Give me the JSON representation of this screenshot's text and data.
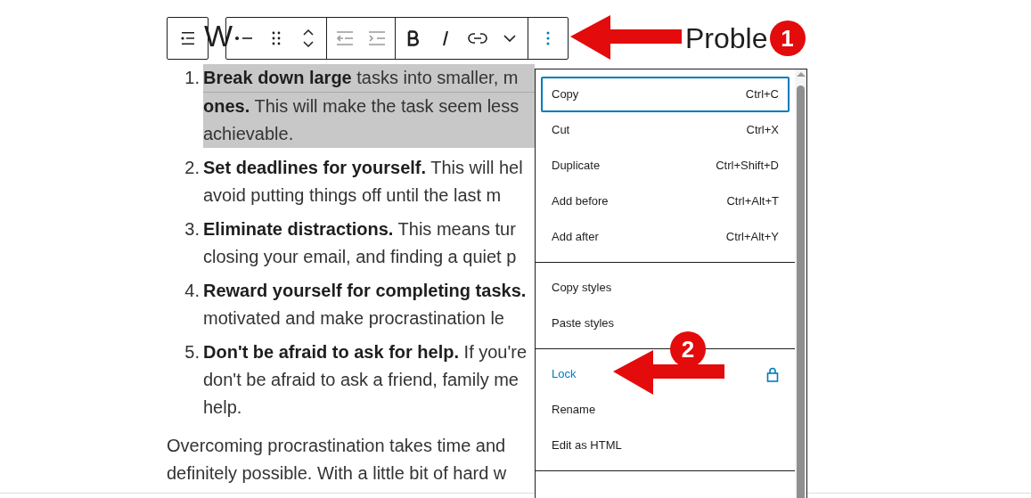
{
  "heading_fragments": [
    "W",
    "Proble"
  ],
  "list": [
    {
      "number": "1.",
      "selected": true,
      "lines": [
        "**Break down large** tasks into smaller, m",
        "**ones.** This will make the task seem less",
        "achievable."
      ]
    },
    {
      "number": "2.",
      "selected": false,
      "lines": [
        "**Set deadlines for yourself.** This will hel",
        "avoid putting things off until the last m"
      ]
    },
    {
      "number": "3.",
      "selected": false,
      "lines": [
        "**Eliminate distractions.** This means tur",
        "closing your email, and finding a quiet p"
      ]
    },
    {
      "number": "4.",
      "selected": false,
      "lines": [
        "**Reward yourself for completing tasks.**",
        "motivated and make procrastination le"
      ]
    },
    {
      "number": "5.",
      "selected": false,
      "lines": [
        "**Don't be afraid to ask for help.** If you're",
        "don't be afraid to ask a friend, family me",
        "help."
      ]
    }
  ],
  "paragraph_lines": [
    "Overcoming procrastination takes time and",
    "definitely possible. With a little bit of hard w"
  ],
  "menu": {
    "sections": [
      [
        {
          "label": "Copy",
          "shortcut": "Ctrl+C",
          "kind": "plain",
          "focused": true
        },
        {
          "label": "Cut",
          "shortcut": "Ctrl+X",
          "kind": "plain",
          "focused": false
        },
        {
          "label": "Duplicate",
          "shortcut": "Ctrl+Shift+D",
          "kind": "plain",
          "focused": false
        },
        {
          "label": "Add before",
          "shortcut": "Ctrl+Alt+T",
          "kind": "plain",
          "focused": false
        },
        {
          "label": "Add after",
          "shortcut": "Ctrl+Alt+Y",
          "kind": "plain",
          "focused": false
        }
      ],
      [
        {
          "label": "Copy styles",
          "kind": "plain",
          "focused": false
        },
        {
          "label": "Paste styles",
          "kind": "plain",
          "focused": false
        }
      ],
      [
        {
          "label": "Lock",
          "kind": "lock",
          "focused": false
        },
        {
          "label": "Rename",
          "kind": "plain",
          "focused": false
        },
        {
          "label": "Edit as HTML",
          "kind": "plain",
          "focused": false
        }
      ]
    ]
  },
  "annotations": [
    {
      "number": "1"
    },
    {
      "number": "2"
    }
  ]
}
